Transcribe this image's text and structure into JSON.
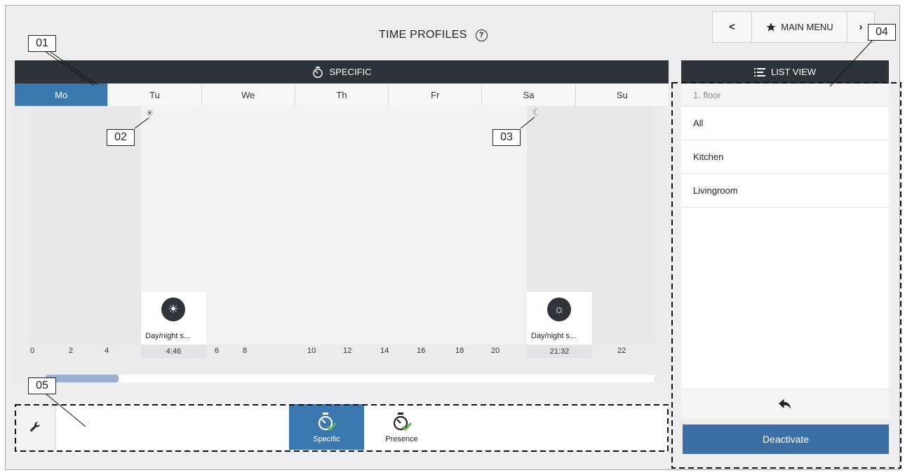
{
  "header": {
    "title": "TIME PROFILES",
    "help_icon": "?",
    "back_label": "<",
    "main_menu_label": "MAIN MENU"
  },
  "schedule": {
    "mode_bar_label": "SPECIFIC",
    "days": [
      "Mo",
      "Tu",
      "We",
      "Th",
      "Fr",
      "Sa",
      "Su"
    ],
    "active_day": "Mo",
    "events": [
      {
        "time": "4:46",
        "label": "Day/night s...",
        "marker_icon": "sun-icon"
      },
      {
        "time": "21:32",
        "label": "Day/night s...",
        "marker_icon": "moon-icon"
      }
    ],
    "hour_ticks": [
      "0",
      "2",
      "4",
      "6",
      "8",
      "10",
      "12",
      "14",
      "16",
      "18",
      "20",
      "22"
    ]
  },
  "list_view": {
    "title": "LIST VIEW",
    "group_header": "1. floor",
    "items": [
      "All",
      "Kitchen",
      "Livingroom"
    ],
    "deactivate_label": "Deactivate"
  },
  "bottom_bar": {
    "modes": [
      {
        "label": "Specific",
        "active": true
      },
      {
        "label": "Presence",
        "active": false
      }
    ]
  },
  "callouts": {
    "c01": "01",
    "c02": "02",
    "c03": "03",
    "c04": "04",
    "c05": "05"
  },
  "colors": {
    "accent_blue": "#3b78b0",
    "dark_bar": "#2e333a",
    "check_green": "#5db34a"
  }
}
